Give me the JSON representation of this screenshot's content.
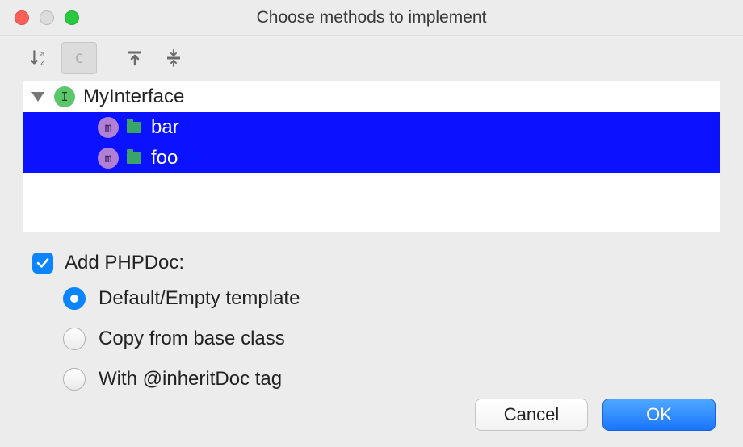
{
  "title": "Choose methods to implement",
  "toolbar": {
    "sort_icon": "sort-alpha-icon",
    "copy_label": "C",
    "expand_icon": "expand-all-icon",
    "collapse_icon": "collapse-all-icon"
  },
  "tree": {
    "root": {
      "name": "MyInterface",
      "badge": "I",
      "children": [
        {
          "name": "bar",
          "badge": "m",
          "selected": true
        },
        {
          "name": "foo",
          "badge": "m",
          "selected": true
        }
      ]
    }
  },
  "options": {
    "add_phpdoc": {
      "label": "Add PHPDoc:",
      "checked": true
    },
    "radio": {
      "selected_index": 0,
      "items": [
        "Default/Empty template",
        "Copy from base class",
        "With @inheritDoc tag"
      ]
    }
  },
  "buttons": {
    "cancel": "Cancel",
    "ok": "OK"
  },
  "colors": {
    "selection": "#0a12ff",
    "accent": "#0a84ff"
  }
}
